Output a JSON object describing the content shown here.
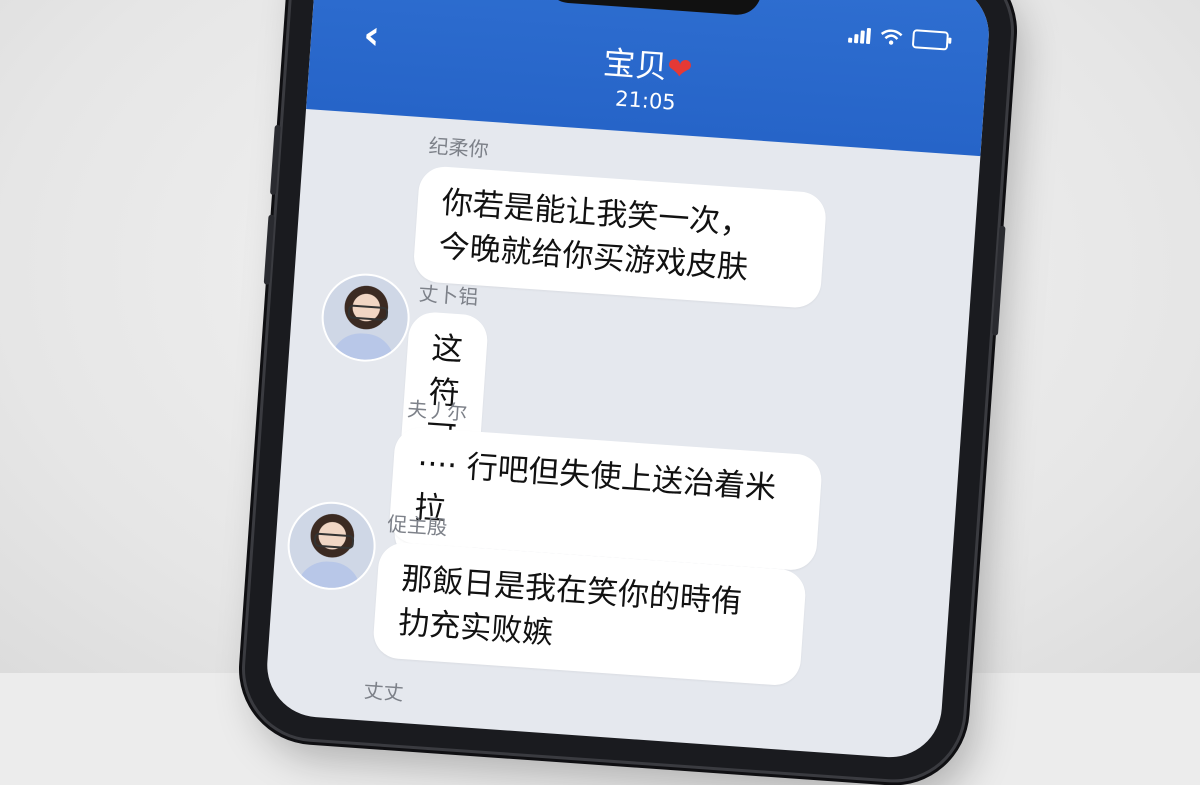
{
  "header": {
    "title": "宝贝",
    "heart": "❤",
    "time": "21:05",
    "back_icon": "‹"
  },
  "messages": [
    {
      "sender": "纪柔你",
      "text": "你若是能让我笑一次，\n今晚就给你买游戏皮肤",
      "has_avatar": false
    },
    {
      "sender": "丈卜铝",
      "text": "这符可切吗",
      "has_avatar": true
    },
    {
      "sender": "夫丿尔",
      "text": "···· 行吧但失使上送治着米拉",
      "has_avatar": false
    },
    {
      "sender": "促主殷",
      "text": "那飯日是我在笑你的時侑\n扐充实败嫉",
      "has_avatar": true
    },
    {
      "sender": "丈丈",
      "text": "",
      "has_avatar": false
    }
  ]
}
